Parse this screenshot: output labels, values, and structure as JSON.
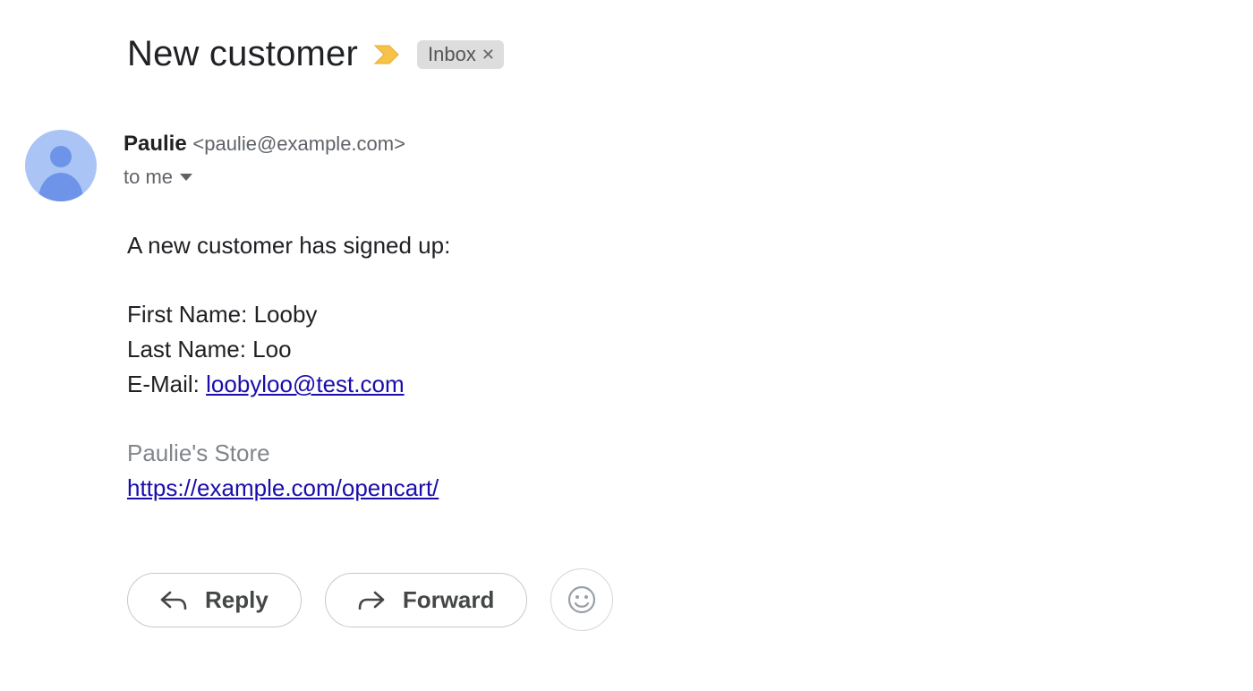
{
  "subject": "New customer",
  "label": {
    "name": "Inbox"
  },
  "sender": {
    "name": "Paulie",
    "address": "<paulie@example.com>"
  },
  "recipient_line": "to me",
  "body": {
    "intro": "A new customer has signed up:",
    "first_name_label": "First Name: ",
    "first_name_value": "Looby",
    "last_name_label": "Last Name: ",
    "last_name_value": "Loo",
    "email_label": "E-Mail: ",
    "email_value": "loobyloo@test.com"
  },
  "signature": {
    "store_name": "Paulie's Store",
    "store_url": "https://example.com/opencart/"
  },
  "actions": {
    "reply": "Reply",
    "forward": "Forward"
  }
}
